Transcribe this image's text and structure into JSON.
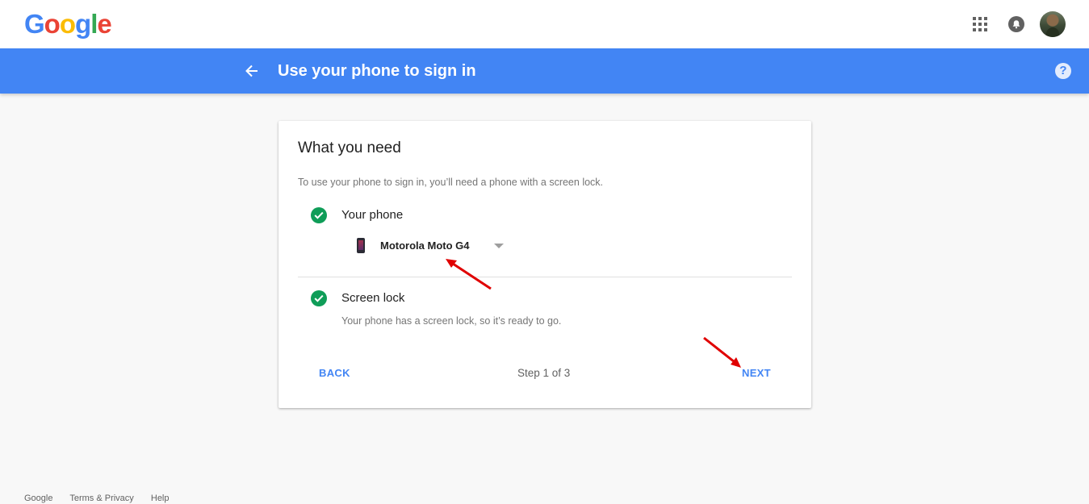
{
  "header": {
    "logo_letters": [
      "G",
      "o",
      "o",
      "g",
      "l",
      "e"
    ],
    "apps_icon": "apps-grid-icon",
    "notifications_icon": "bell-icon",
    "avatar_icon": "account-avatar"
  },
  "title_bar": {
    "title": "Use your phone to sign in",
    "back_icon": "arrow-left-icon",
    "help_icon": "help-icon",
    "help_symbol": "?",
    "color": "#4285f4"
  },
  "card": {
    "title": "What you need",
    "description": "To use your phone to sign in, you’ll need a phone with a screen lock.",
    "requirements": [
      {
        "label": "Your phone",
        "status_icon": "check-circle-icon",
        "device_icon": "smartphone-icon",
        "selected_device": "Motorola Moto G4"
      },
      {
        "label": "Screen lock",
        "status_icon": "check-circle-icon",
        "detail": "Your phone has a screen lock, so it’s ready to go."
      }
    ],
    "back_label": "BACK",
    "step_text": "Step 1 of 3",
    "next_label": "NEXT",
    "check_color": "#0f9d58",
    "accent": "#4285f4"
  },
  "annotations": {
    "arrow_color": "#e00000",
    "arrows": [
      "points-to-device-select",
      "points-to-next-button"
    ]
  },
  "footer": {
    "links": [
      "Google",
      "Terms & Privacy",
      "Help"
    ]
  }
}
